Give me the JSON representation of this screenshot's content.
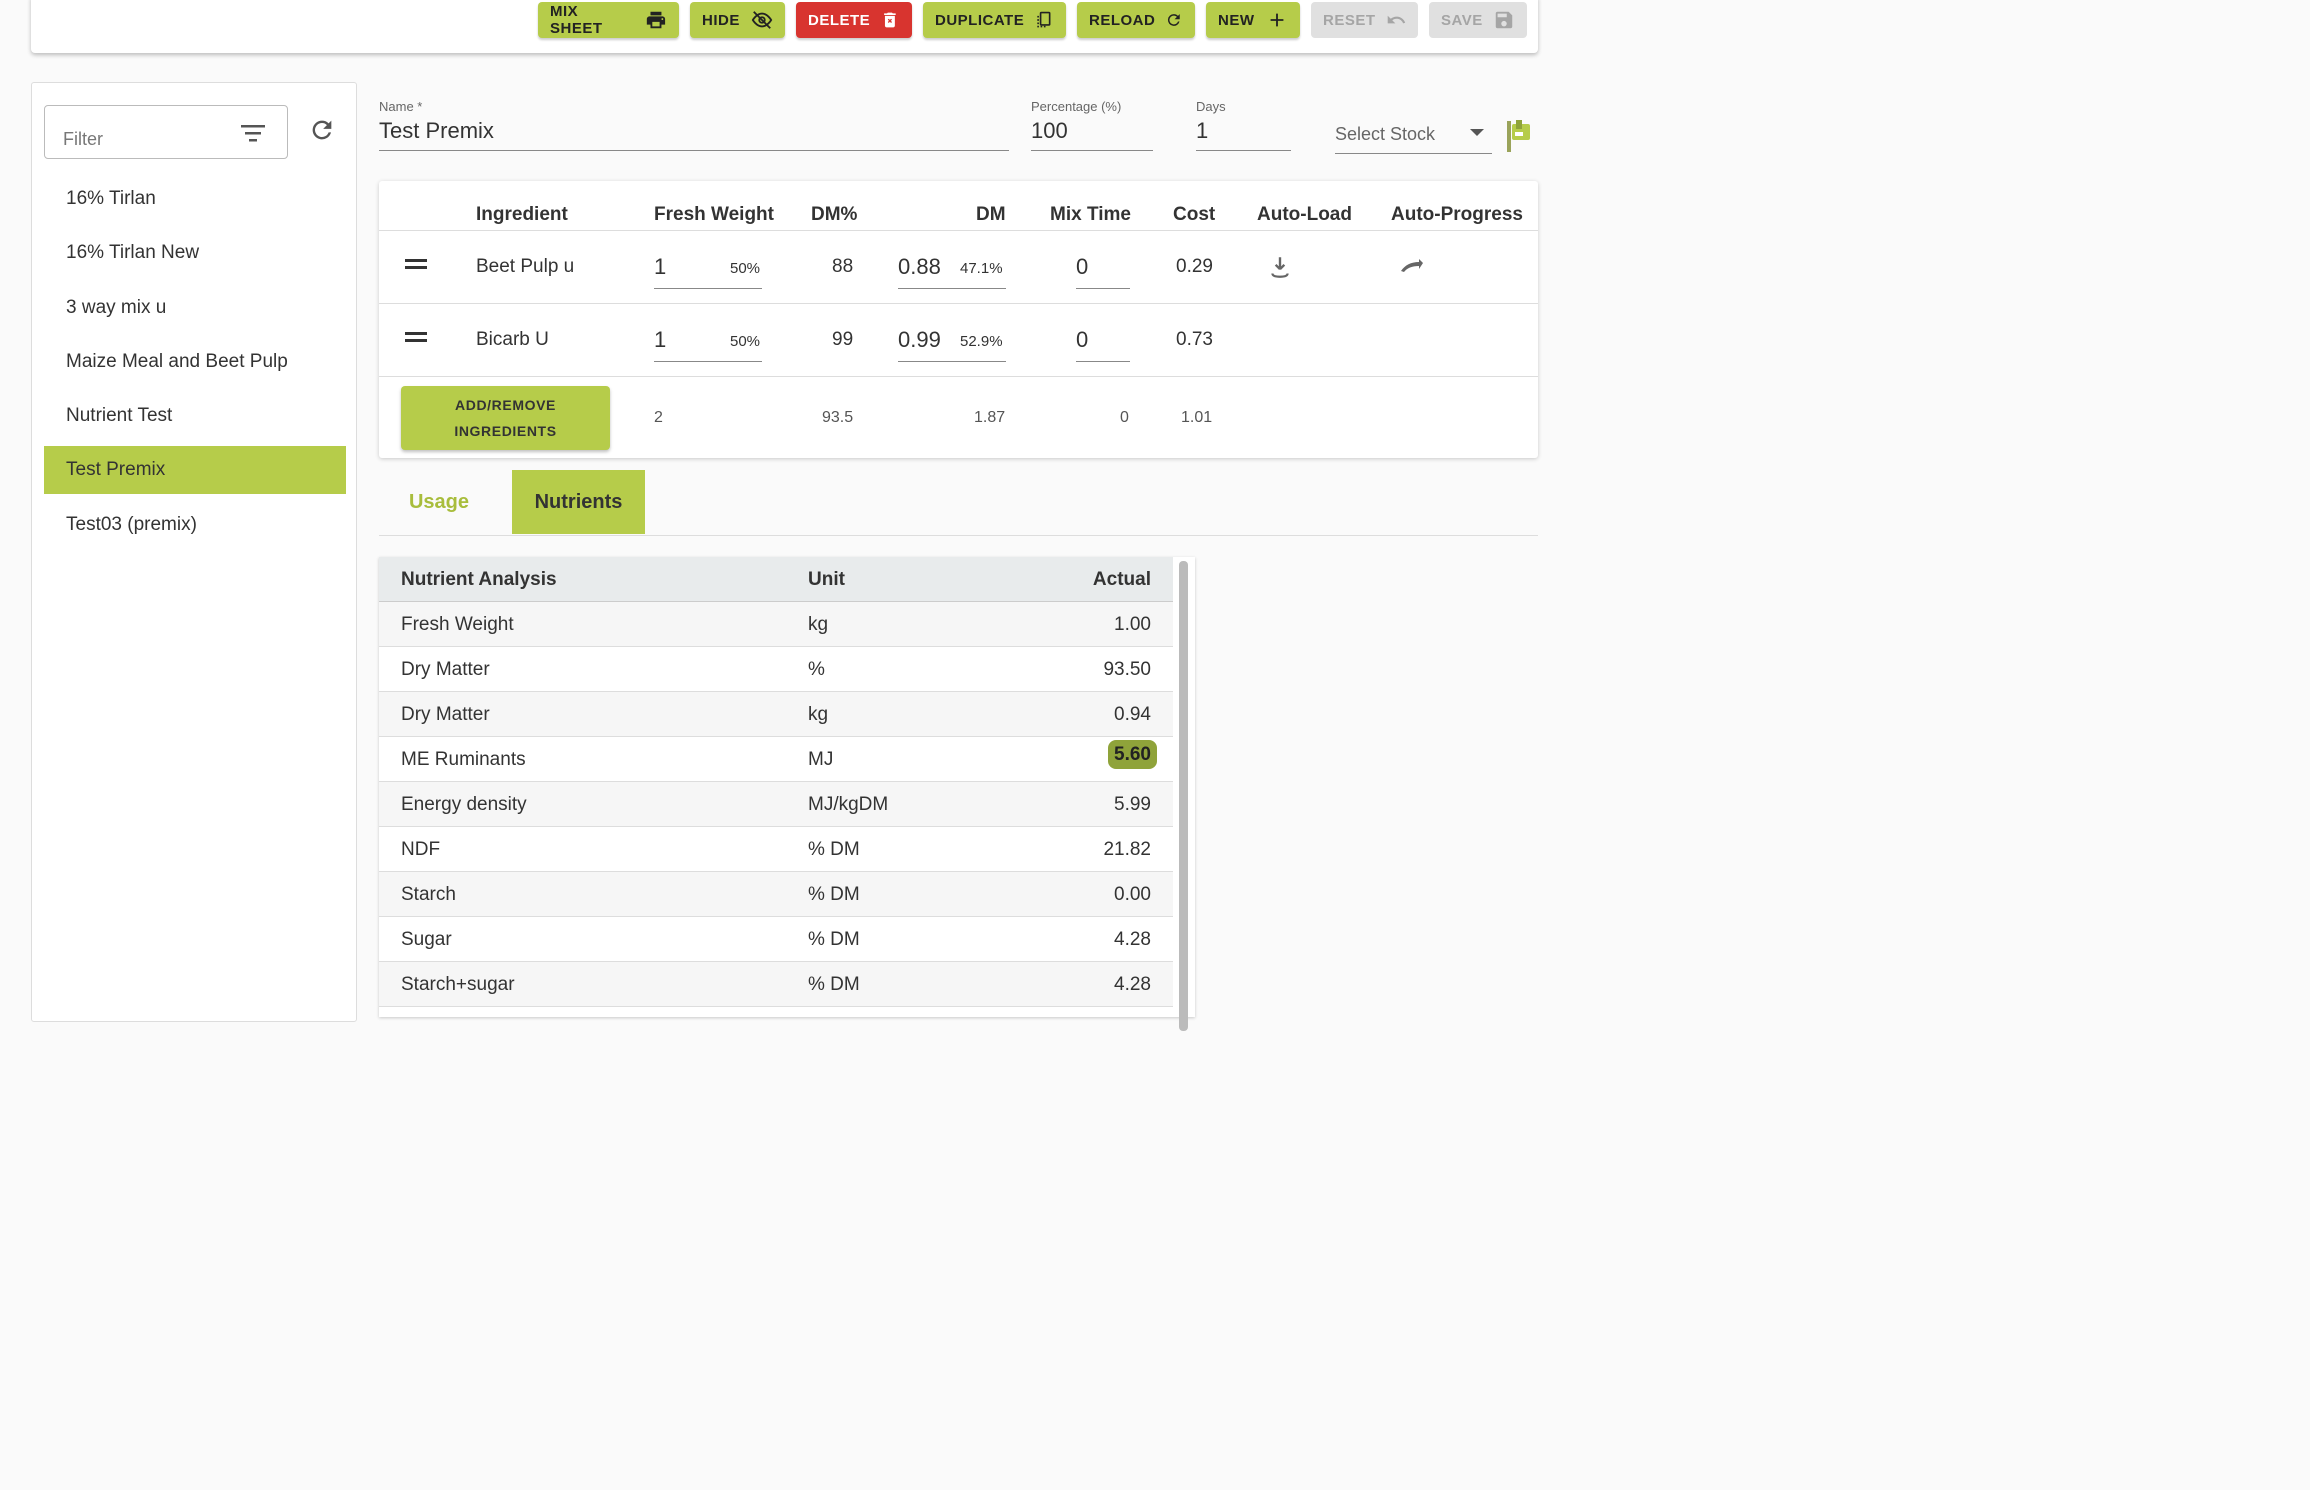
{
  "toolbar": {
    "mix_sheet": "MIX SHEET",
    "hide": "HIDE",
    "delete": "DELETE",
    "duplicate": "DUPLICATE",
    "reload": "RELOAD",
    "new": "NEW",
    "reset": "RESET",
    "save": "SAVE"
  },
  "sidebar": {
    "filter_placeholder": "Filter",
    "items": [
      {
        "label": "16% Tirlan"
      },
      {
        "label": "16% Tirlan New"
      },
      {
        "label": "3 way mix u"
      },
      {
        "label": "Maize Meal and Beet Pulp"
      },
      {
        "label": "Nutrient Test"
      },
      {
        "label": "Test Premix"
      },
      {
        "label": "Test03 (premix)"
      }
    ],
    "active_index": 5
  },
  "form": {
    "name_label": "Name *",
    "name_value": "Test Premix",
    "percentage_label": "Percentage (%)",
    "percentage_value": "100",
    "days_label": "Days",
    "days_value": "1",
    "stock_placeholder": "Select Stock"
  },
  "ingredients": {
    "headers": {
      "ingredient": "Ingredient",
      "fresh_weight": "Fresh Weight",
      "dm_pct": "DM%",
      "dm": "DM",
      "mix_time": "Mix Time",
      "cost": "Cost",
      "auto_load": "Auto-Load",
      "auto_progress": "Auto-Progress"
    },
    "rows": [
      {
        "name": "Beet Pulp u",
        "fresh_weight": "1",
        "fw_pct": "50%",
        "dm_pct": "88",
        "dm": "0.88",
        "dm_share": "47.1%",
        "mix_time": "0",
        "cost": "0.29"
      },
      {
        "name": "Bicarb U",
        "fresh_weight": "1",
        "fw_pct": "50%",
        "dm_pct": "99",
        "dm": "0.99",
        "dm_share": "52.9%",
        "mix_time": "0",
        "cost": "0.73"
      }
    ],
    "add_remove_line1": "ADD/REMOVE",
    "add_remove_line2": "INGREDIENTS",
    "totals": {
      "fresh_weight": "2",
      "dm_pct": "93.5",
      "dm": "1.87",
      "mix_time": "0",
      "cost": "1.01"
    }
  },
  "tabs": {
    "usage": "Usage",
    "nutrients": "Nutrients"
  },
  "nutrients": {
    "headers": {
      "name": "Nutrient Analysis",
      "unit": "Unit",
      "actual": "Actual"
    },
    "rows": [
      {
        "name": "Fresh Weight",
        "unit": "kg",
        "actual": "1.00"
      },
      {
        "name": "Dry Matter",
        "unit": "%",
        "actual": "93.50"
      },
      {
        "name": "Dry Matter",
        "unit": "kg",
        "actual": "0.94"
      },
      {
        "name": "ME Ruminants",
        "unit": "MJ",
        "actual": "5.60"
      },
      {
        "name": "Energy density",
        "unit": "MJ/kgDM",
        "actual": "5.99"
      },
      {
        "name": "NDF",
        "unit": "% DM",
        "actual": "21.82"
      },
      {
        "name": "Starch",
        "unit": "% DM",
        "actual": "0.00"
      },
      {
        "name": "Sugar",
        "unit": "% DM",
        "actual": "4.28"
      },
      {
        "name": "Starch+sugar",
        "unit": "% DM",
        "actual": "4.28"
      }
    ]
  },
  "colors": {
    "accent": "#b6cc4a",
    "danger": "#d8342f",
    "highlight": "#8fa33a"
  }
}
